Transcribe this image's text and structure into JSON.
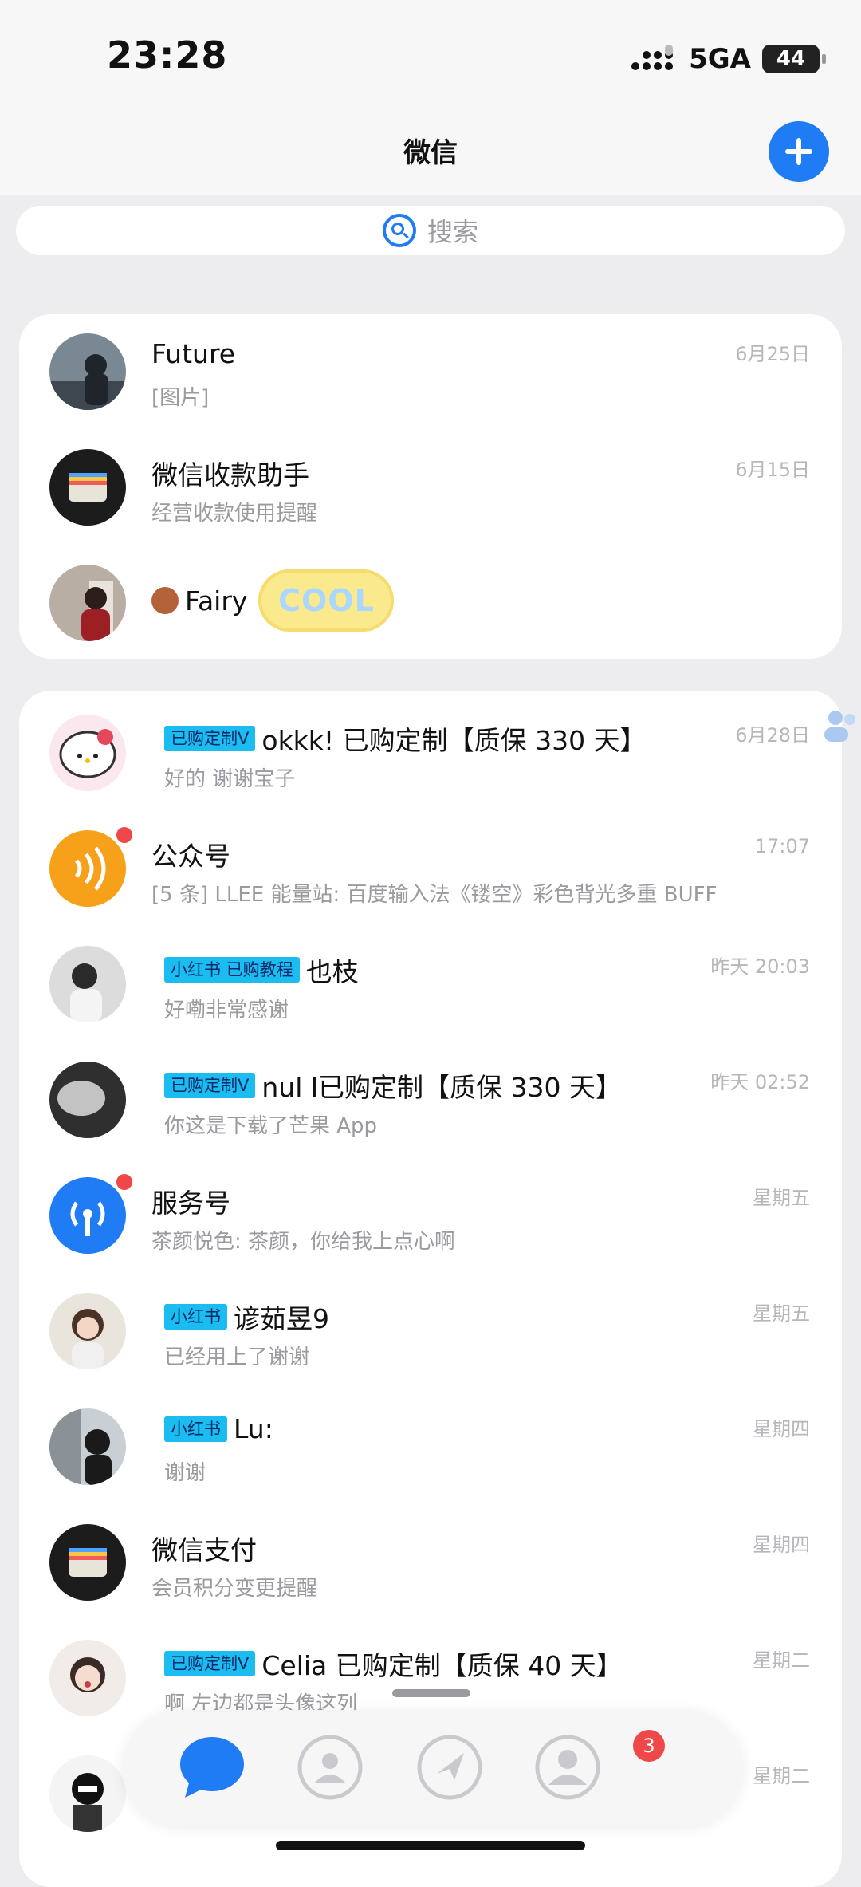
{
  "status_bar": {
    "time": "23:28",
    "network": "5GA",
    "battery": "44"
  },
  "header": {
    "title": "微信"
  },
  "search": {
    "placeholder": "搜索"
  },
  "pinned": [
    {
      "name": "Future",
      "preview": "[图片]",
      "time": "6月25日"
    },
    {
      "name": "微信收款助手",
      "preview": "经营收款使用提醒",
      "time": "6月15日"
    },
    {
      "name": "Fairy",
      "sticker_text": "COOL"
    }
  ],
  "chats": [
    {
      "tag": "已购定制V",
      "name": "okkk! 已购定制【质保 330 天】",
      "preview": "好的 谢谢宝子",
      "time": "6月28日"
    },
    {
      "name": "公众号",
      "preview": "[5 条] LLEE 能量站: 百度输入法《镂空》彩色背光多重 BUFF",
      "time": "17:07",
      "unread": true
    },
    {
      "tag": "小红书 已购教程",
      "name": "也枝",
      "preview": "好嘞非常感谢",
      "time": "昨天 20:03"
    },
    {
      "tag": "已购定制V",
      "name": "nul l已购定制【质保 330 天】",
      "preview": "你这是下载了芒果 App",
      "time": "昨天 02:52"
    },
    {
      "name": "服务号",
      "preview": "茶颜悦色: 茶颜，你给我上点心啊",
      "time": "星期五",
      "unread": true
    },
    {
      "tag": "小红书",
      "name": "谚茹昱9",
      "preview": "已经用上了谢谢",
      "time": "星期五"
    },
    {
      "tag": "小红书",
      "name": "Lu:",
      "preview": "谢谢",
      "time": "星期四"
    },
    {
      "name": "微信支付",
      "preview": "会员积分变更提醒",
      "time": "星期四"
    },
    {
      "tag": "已购定制V",
      "name": "Celia 已购定制【质保 40 天】",
      "preview": "啊 左边都是头像这列",
      "time": "星期二"
    },
    {
      "time": "星期二"
    }
  ],
  "tabbar": {
    "items": [
      "chats-tab",
      "contacts-tab",
      "discover-tab",
      "me-tab"
    ],
    "discover_badge": "3",
    "accent": "#1f7cf5"
  }
}
